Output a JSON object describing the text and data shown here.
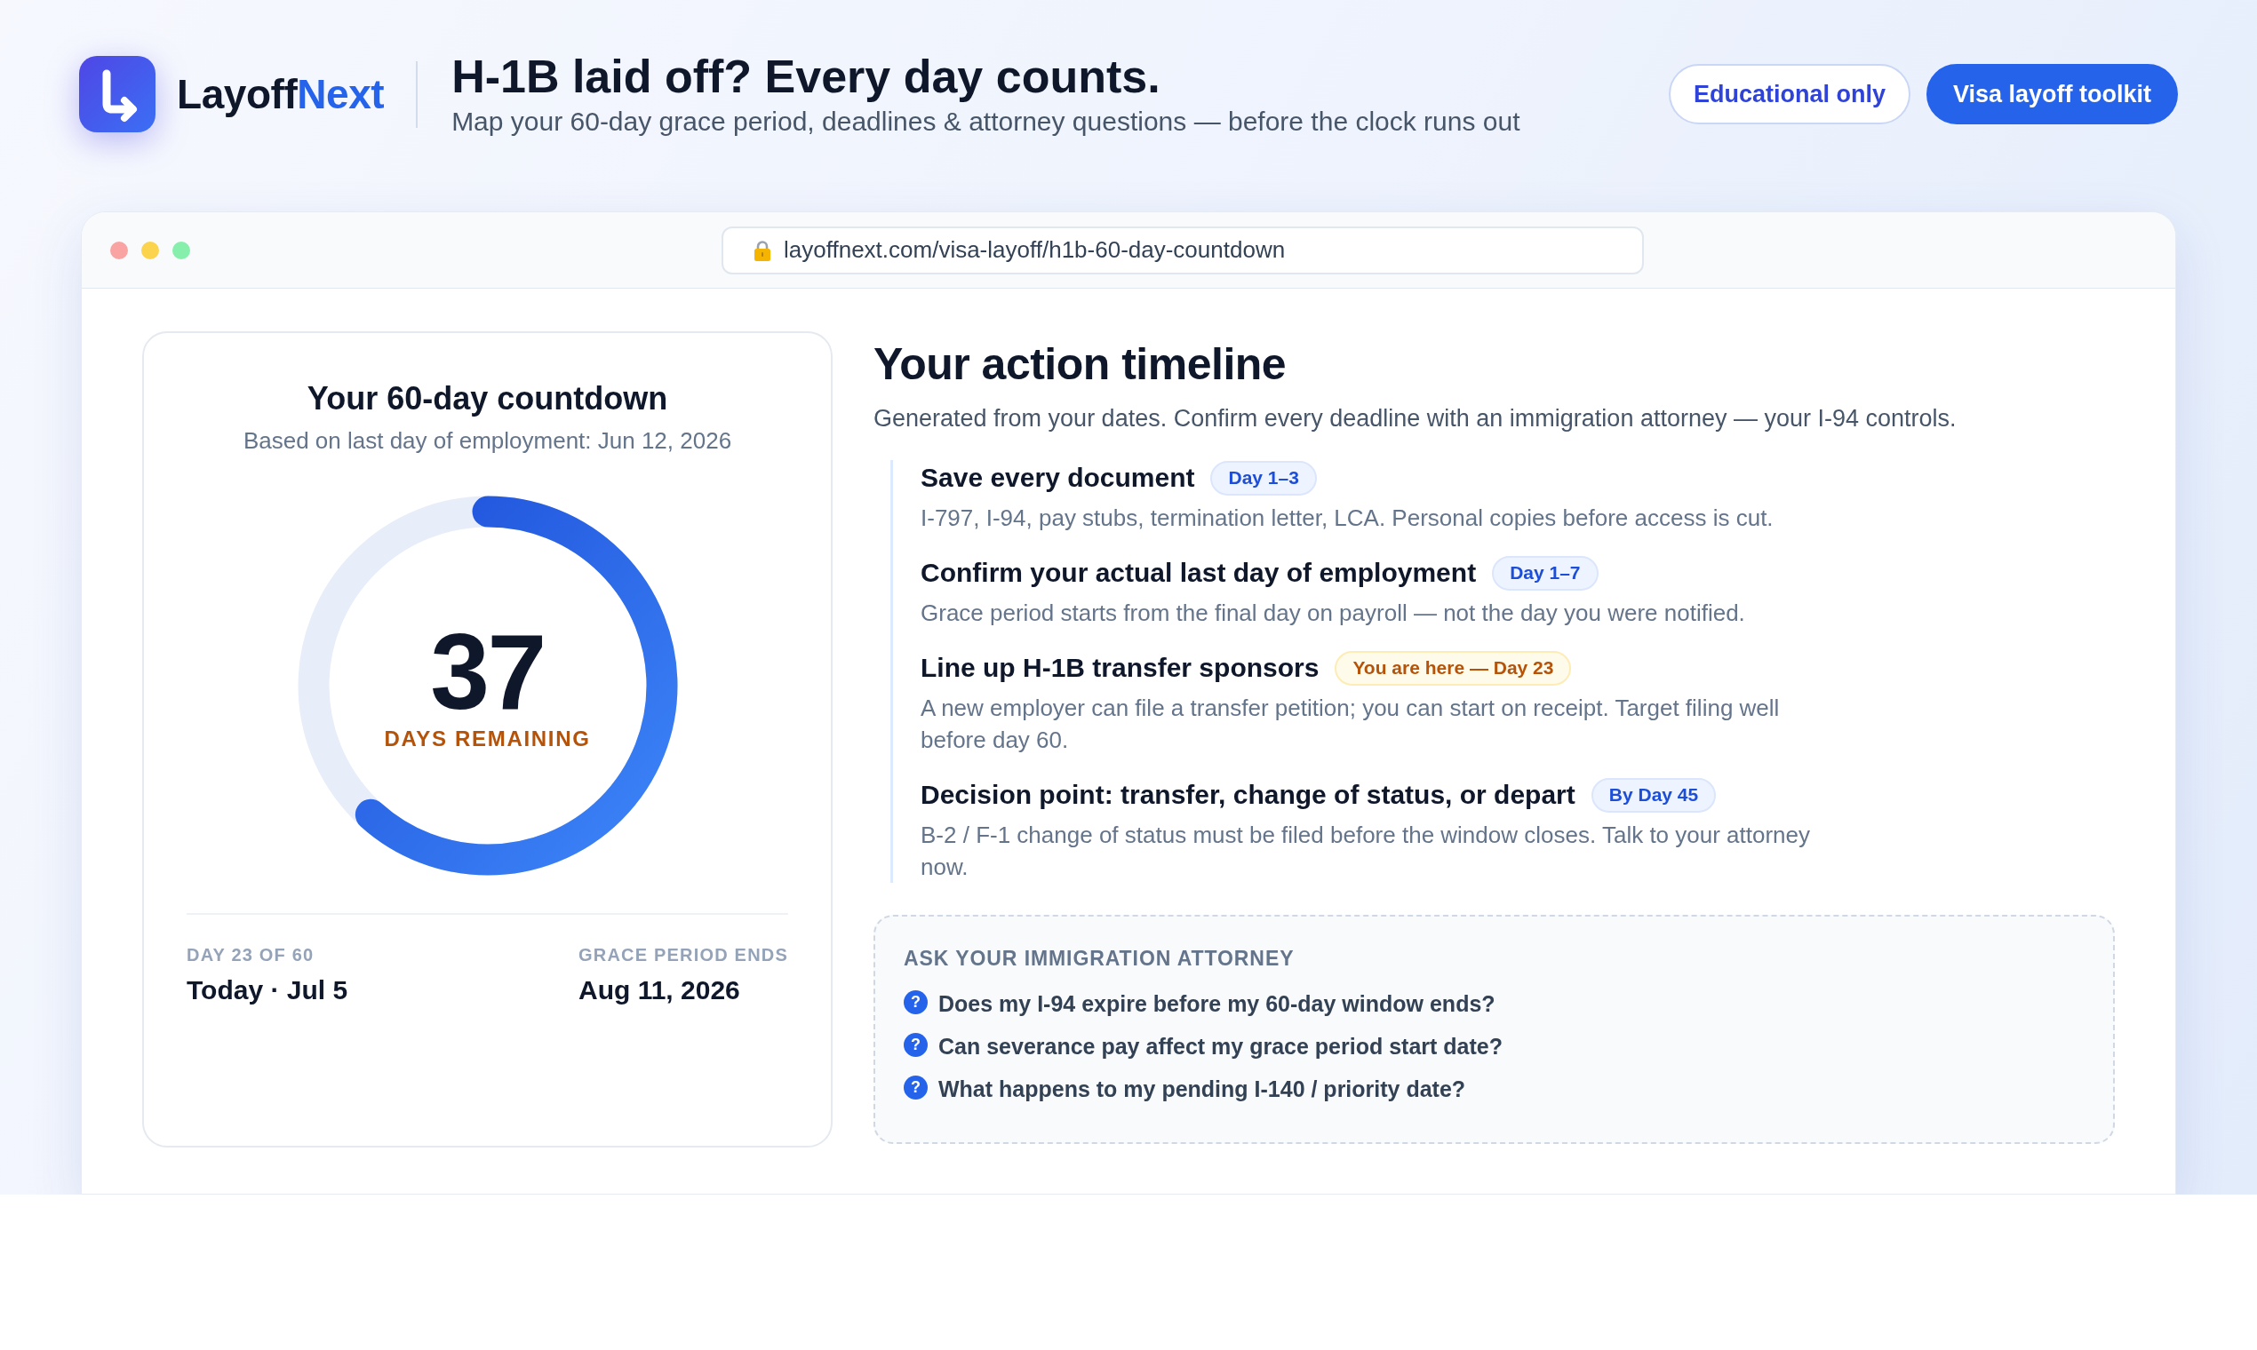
{
  "brand": {
    "name": "Layoff",
    "accent": "Next"
  },
  "header": {
    "title": "H-1B laid off? Every day counts.",
    "subtitle": "Map your 60-day grace period, deadlines & attorney questions — before the clock runs out"
  },
  "actions": [
    {
      "label": "Educational only",
      "kind": "outline"
    },
    {
      "label": "Visa layoff toolkit",
      "kind": "primary"
    }
  ],
  "browser": {
    "url": "layoffnext.com/visa-layoff/h1b-60-day-countdown"
  },
  "countdown": {
    "title": "Your 60-day countdown",
    "subtitle": "Based on last day of employment: Jun 12, 2026",
    "days": "37",
    "days_label": "DAYS REMAINING",
    "level": 0.617,
    "stats": [
      {
        "label": "DAY 23 OF 60",
        "value": "Today · Jul 5"
      },
      {
        "label": "GRACE PERIOD ENDS",
        "value": "Aug 11, 2026"
      }
    ]
  },
  "timeline": {
    "title": "Your action timeline",
    "subtitle": "Generated from your dates. Confirm every deadline with an immigration attorney — your I-94 controls.",
    "steps": [
      {
        "title": "Save every document",
        "badge": "Day 1–3",
        "current": false,
        "description": "I-797, I-94, pay stubs, termination letter, LCA. Personal copies before access is cut."
      },
      {
        "title": "Confirm your actual last day of employment",
        "badge": "Day 1–7",
        "current": false,
        "description": "Grace period starts from the final day on payroll — not the day you were notified."
      },
      {
        "title": "Line up H-1B transfer sponsors",
        "badge": "You are here — Day 23",
        "current": true,
        "description": "A new employer can file a transfer petition; you can start on receipt. Target filing well before day 60."
      },
      {
        "title": "Decision point: transfer, change of status, or depart",
        "badge": "By Day 45",
        "current": false,
        "description": "B-2 / F-1 change of status must be filed before the window closes. Talk to your attorney now."
      }
    ]
  },
  "attorney_questions": {
    "title": "ASK YOUR IMMIGRATION ATTORNEY",
    "items": [
      {
        "icon": "?",
        "text": "Does my I-94 expire before my 60-day window ends?"
      },
      {
        "icon": "?",
        "text": "Can severance pay affect my grace period start date?"
      },
      {
        "icon": "?",
        "text": "What happens to my pending I-140 / priority date?"
      }
    ]
  }
}
